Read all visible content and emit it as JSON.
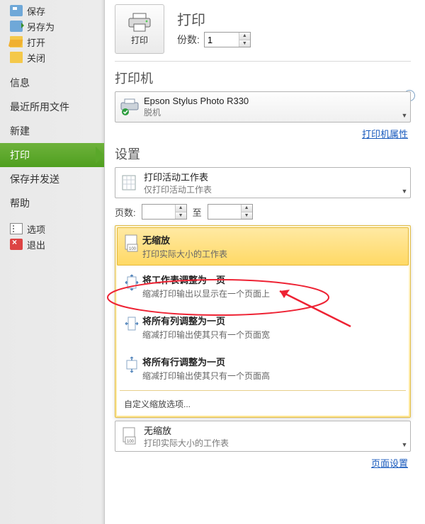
{
  "sidebar": {
    "save": "保存",
    "save_as": "另存为",
    "open": "打开",
    "close": "关闭",
    "info": "信息",
    "recent": "最近所用文件",
    "new": "新建",
    "print": "打印",
    "save_send": "保存并发送",
    "help": "帮助",
    "options": "选项",
    "exit": "退出"
  },
  "print": {
    "title": "打印",
    "button": "打印",
    "copies_label": "份数:",
    "copies_value": "1"
  },
  "printer": {
    "section": "打印机",
    "name": "Epson Stylus Photo R330",
    "status": "脱机",
    "properties": "打印机属性"
  },
  "settings": {
    "section": "设置",
    "sheets_title": "打印活动工作表",
    "sheets_desc": "仅打印活动工作表",
    "pages_label": "页数:",
    "pages_to": "至",
    "page_setup": "页面设置"
  },
  "scaling": {
    "options": [
      {
        "title": "无缩放",
        "desc": "打印实际大小的工作表"
      },
      {
        "title": "将工作表调整为一页",
        "desc": "缩减打印输出以显示在一个页面上"
      },
      {
        "title": "将所有列调整为一页",
        "desc": "缩减打印输出使其只有一个页面宽"
      },
      {
        "title": "将所有行调整为一页",
        "desc": "缩减打印输出使其只有一个页面高"
      }
    ],
    "custom": "自定义缩放选项...",
    "current_title": "无缩放",
    "current_desc": "打印实际大小的工作表"
  }
}
